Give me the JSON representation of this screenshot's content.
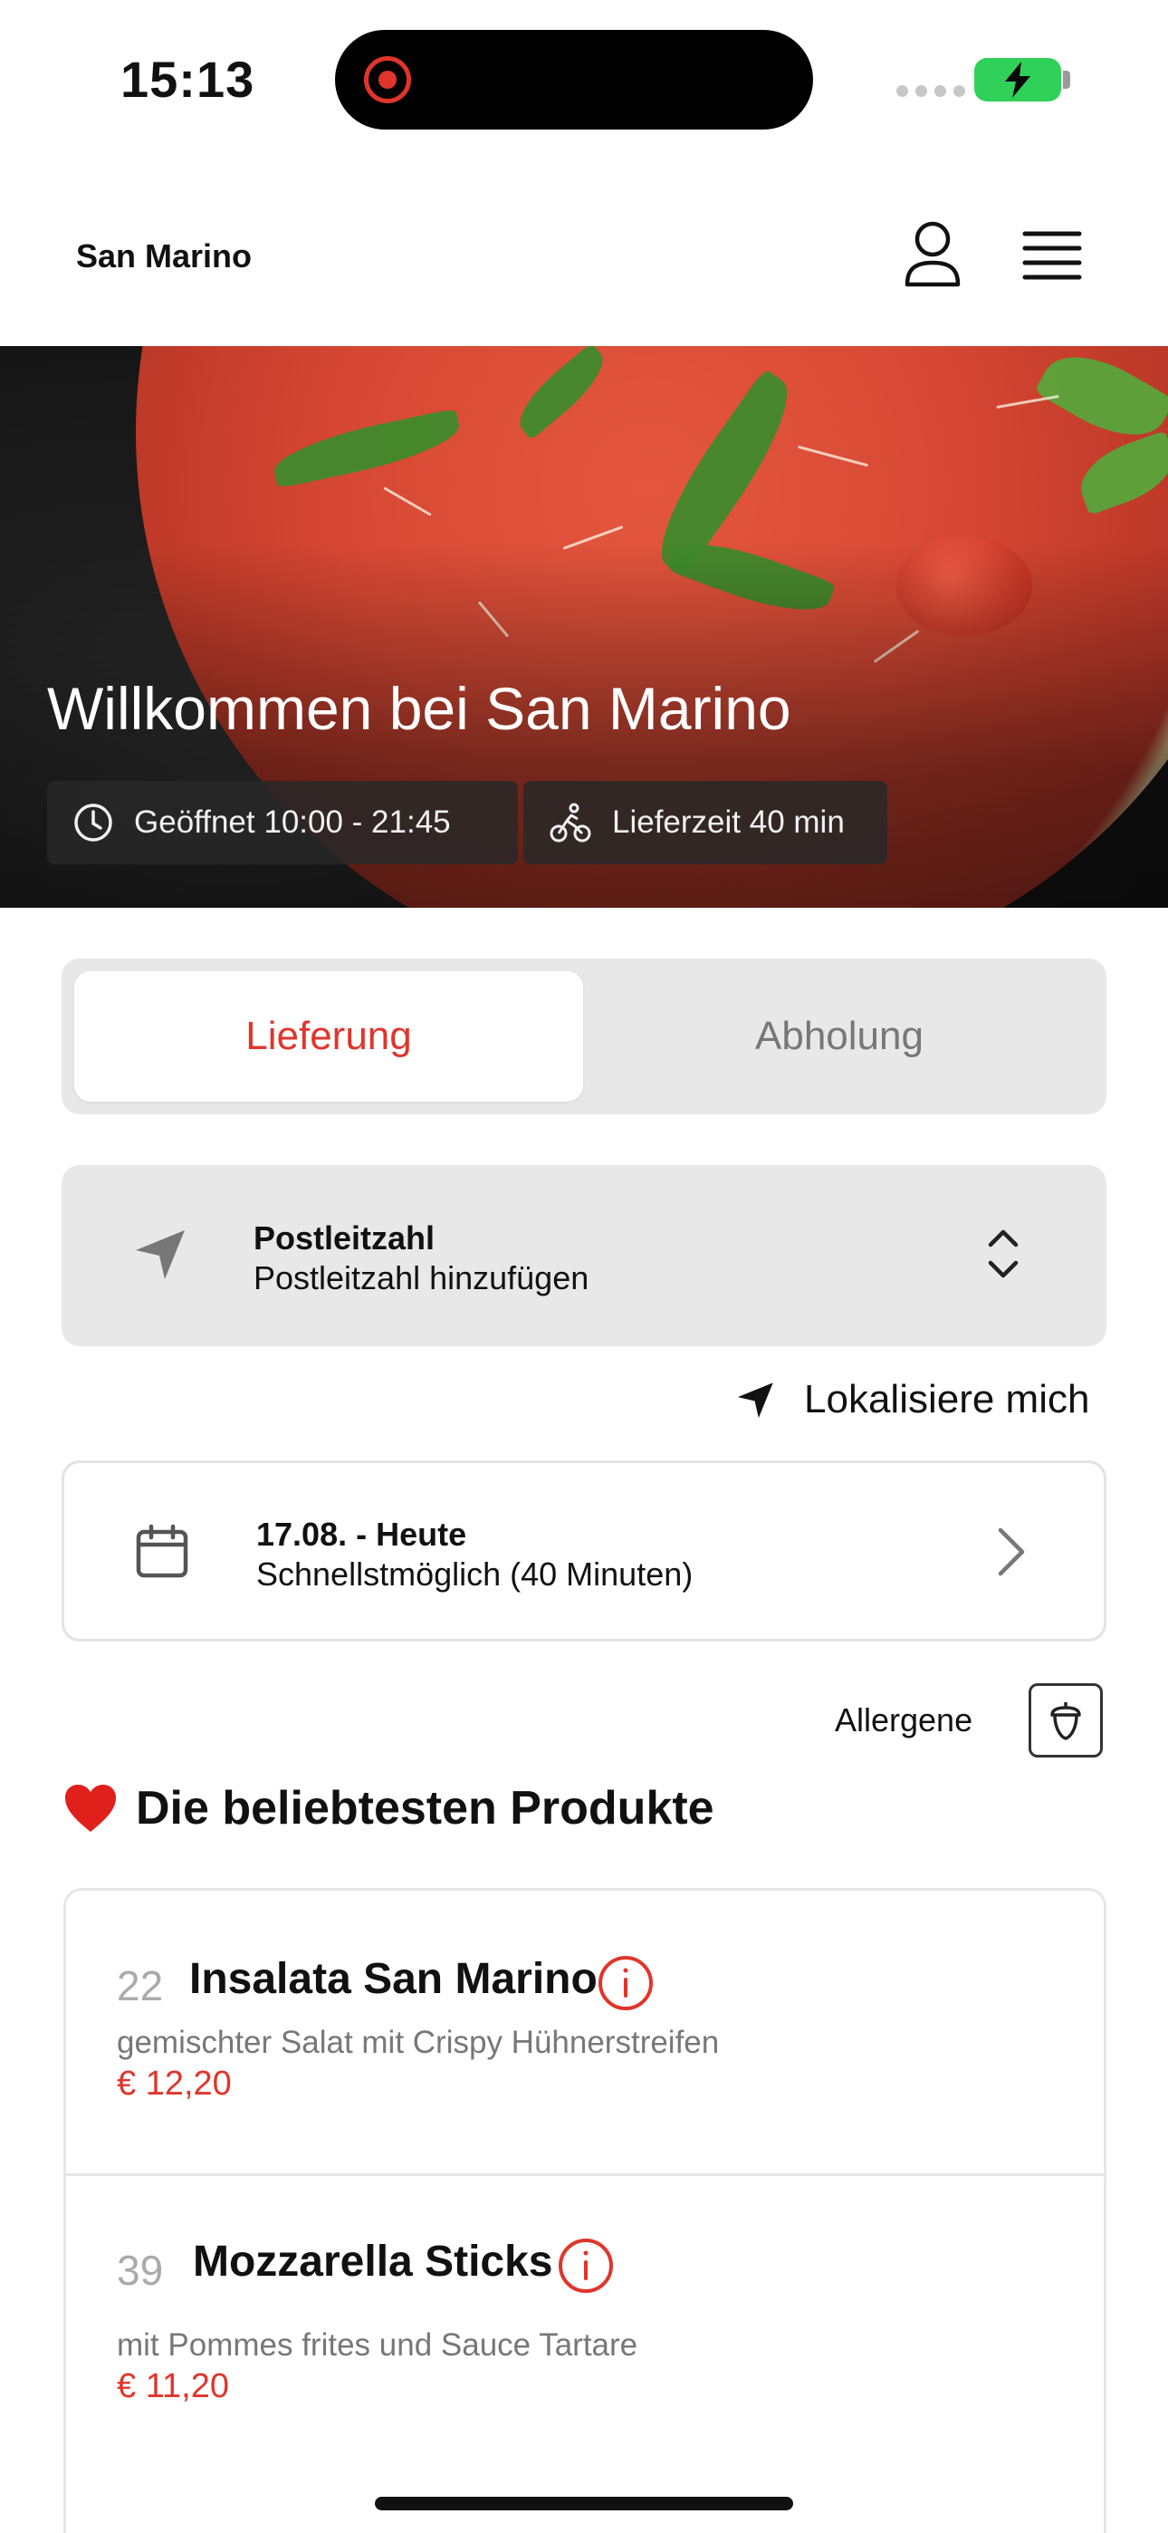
{
  "status_bar": {
    "time": "15:13"
  },
  "header": {
    "brand": "San Marino"
  },
  "hero": {
    "title": "Willkommen bei San Marino",
    "opening_hours": "Geöffnet 10:00 - 21:45",
    "delivery_time": "Lieferzeit 40 min"
  },
  "order_mode": {
    "options": [
      "Lieferung",
      "Abholung"
    ],
    "selected": "Lieferung"
  },
  "postcode": {
    "label": "Postleitzahl",
    "value": "Postleitzahl hinzufügen"
  },
  "locate_label": "Lokalisiere mich",
  "schedule": {
    "date": "17.08. - Heute",
    "time": "Schnellstmöglich (40 Minuten)"
  },
  "allergens_label": "Allergene",
  "popular": {
    "title": "Die beliebtesten Produkte",
    "products": [
      {
        "number": "22",
        "name": "Insalata San Marino",
        "description": "gemischter Salat mit Crispy Hühnerstreifen",
        "price": "€ 12,20"
      },
      {
        "number": "39",
        "name": "Mozzarella Sticks",
        "description": "mit Pommes frites und Sauce Tartare",
        "price": "€ 11,20"
      }
    ]
  },
  "colors": {
    "accent": "#e0352b",
    "battery": "#2fd158",
    "muted_bg": "#e8e8e8"
  },
  "icons": [
    "record-icon",
    "battery-icon",
    "user-icon",
    "hamburger-menu-icon",
    "clock-icon",
    "bike-icon",
    "navigation-arrow-icon",
    "chevron-up-down-icon",
    "calendar-icon",
    "chevron-right-icon",
    "acorn-icon",
    "heart-icon",
    "info-icon"
  ]
}
